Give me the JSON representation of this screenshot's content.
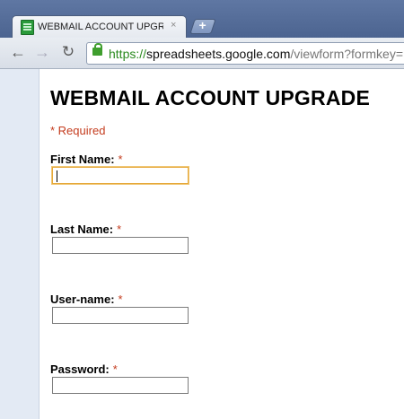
{
  "browser": {
    "tab_title": "WEBMAIL ACCOUNT UPGR...",
    "tab_close": "×",
    "new_tab": "+",
    "url_scheme": "https://",
    "url_host": "spreadsheets.google.com",
    "url_path": "/viewform?formkey=",
    "nav_back": "←",
    "nav_forward": "→",
    "nav_reload": "↻"
  },
  "form": {
    "title": "WEBMAIL ACCOUNT UPGRADE",
    "required_note": "* Required",
    "star": "*",
    "fields": [
      {
        "label": "First Name:",
        "value": ""
      },
      {
        "label": "Last Name:",
        "value": ""
      },
      {
        "label": "User-name:",
        "value": ""
      },
      {
        "label": "Password:",
        "value": ""
      }
    ]
  }
}
